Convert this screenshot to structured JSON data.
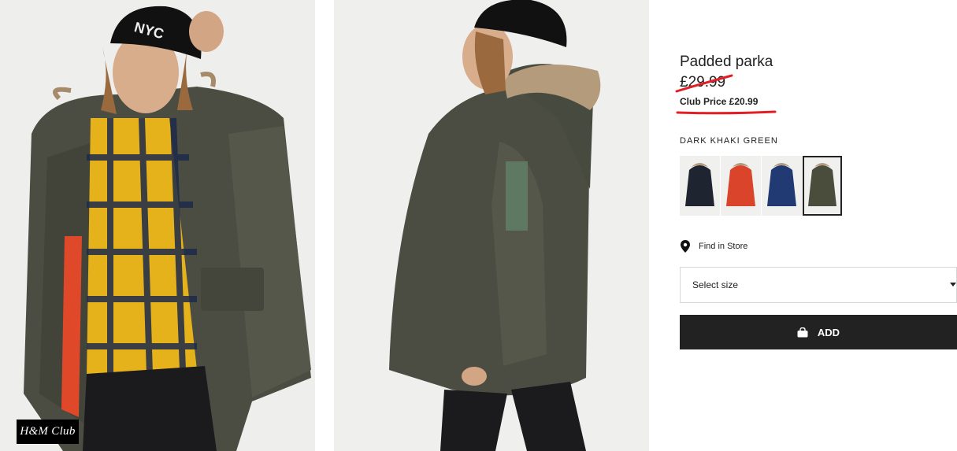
{
  "images": [
    {
      "name": "product-photo-front"
    },
    {
      "name": "product-photo-side"
    }
  ],
  "badge": {
    "text": "H&M Club"
  },
  "product": {
    "title": "Padded parka",
    "old_price": "£29.99",
    "club_price": "Club Price £20.99",
    "color_name": "DARK KHAKI GREEN"
  },
  "swatches": [
    {
      "color": "#1f2530",
      "icon": "black-parka-thumbnail"
    },
    {
      "color": "#d9442a",
      "icon": "red-parka-thumbnail"
    },
    {
      "color": "#223a73",
      "icon": "navy-parka-thumbnail"
    },
    {
      "color": "#4a4d3c",
      "icon": "khaki-parka-thumbnail",
      "selected": true
    }
  ],
  "find_store": {
    "label": "Find in Store",
    "icon": "map-pin-icon"
  },
  "size_select": {
    "placeholder": "Select size",
    "icon": "caret-down-icon"
  },
  "add_button": {
    "label": "ADD",
    "icon": "shopping-bag-icon"
  },
  "colors": {
    "annotation_red": "#e31e24",
    "button_bg": "#222222"
  }
}
